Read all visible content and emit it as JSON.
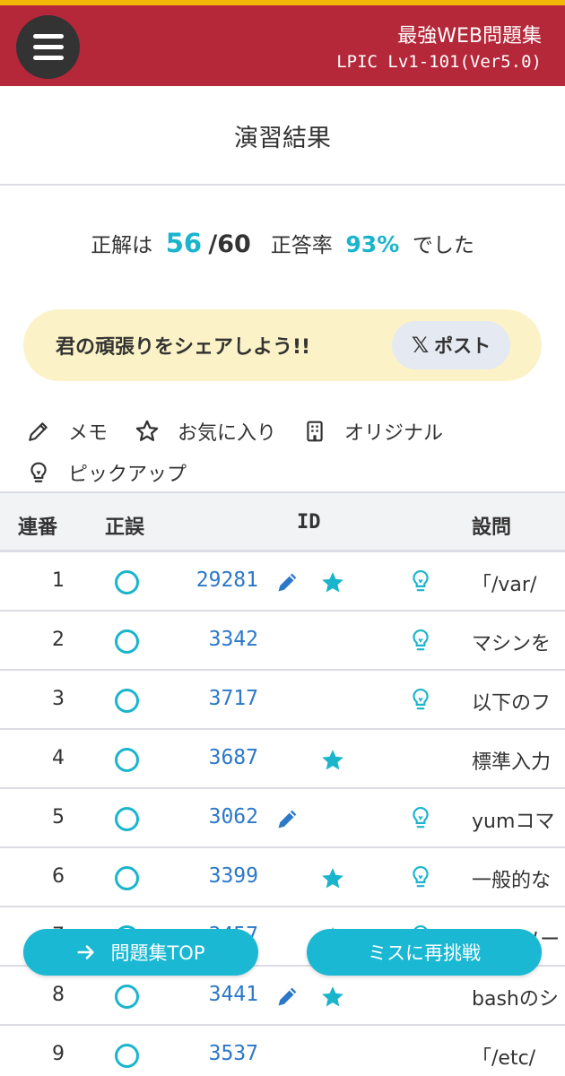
{
  "header": {
    "site_title": "最強WEB問題集",
    "subtitle": "LPIC Lv1-101(Ver5.0)",
    "accent": "#b5283a"
  },
  "page_title": "演習結果",
  "score": {
    "prefix": "正解は",
    "correct": "56",
    "total": "/60",
    "rate_label": "正答率",
    "rate": "93%",
    "suffix": "でした"
  },
  "share": {
    "text": "君の頑張りをシェアしよう!!",
    "post_icon": "𝕏",
    "post_label": "ポスト"
  },
  "legend": {
    "memo": "メモ",
    "favorite": "お気に入り",
    "original": "オリジナル",
    "pickup": "ピックアップ"
  },
  "table": {
    "headers": {
      "no": "連番",
      "result": "正誤",
      "id": "ID",
      "question": "設問"
    },
    "rows": [
      {
        "no": "1",
        "id": "29281",
        "memo": true,
        "fav": true,
        "pickup": true,
        "question": "「/var/"
      },
      {
        "no": "2",
        "id": "3342",
        "memo": false,
        "fav": false,
        "pickup": true,
        "question": "マシンを"
      },
      {
        "no": "3",
        "id": "3717",
        "memo": false,
        "fav": false,
        "pickup": true,
        "question": "以下のフ"
      },
      {
        "no": "4",
        "id": "3687",
        "memo": false,
        "fav": true,
        "pickup": false,
        "question": "標準入力"
      },
      {
        "no": "5",
        "id": "3062",
        "memo": true,
        "fav": false,
        "pickup": true,
        "question": "yumコマ"
      },
      {
        "no": "6",
        "id": "3399",
        "memo": false,
        "fav": true,
        "pickup": true,
        "question": "一般的な"
      },
      {
        "no": "7",
        "id": "3457",
        "memo": false,
        "fav": true,
        "pickup": true,
        "question": "UNIXソー"
      },
      {
        "no": "8",
        "id": "3441",
        "memo": true,
        "fav": true,
        "pickup": false,
        "question": "bashのシ"
      },
      {
        "no": "9",
        "id": "3537",
        "memo": false,
        "fav": false,
        "pickup": false,
        "question": "「/etc/"
      }
    ]
  },
  "buttons": {
    "top_label": "問題集TOP",
    "retry_label": "ミスに再挑戦"
  },
  "colors": {
    "teal": "#1ab5cc",
    "link": "#2c78c8"
  }
}
